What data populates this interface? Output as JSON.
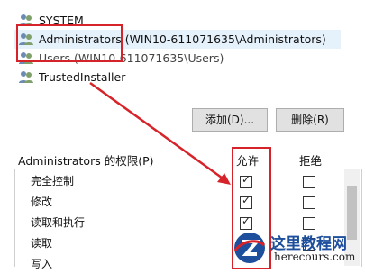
{
  "users": [
    {
      "name": "SYSTEM"
    },
    {
      "name": "Administrators (WIN10-611071635\\Administrators)"
    },
    {
      "name": "Users (WIN10-611071635\\Users)"
    },
    {
      "name": "TrustedInstaller"
    }
  ],
  "buttons": {
    "add": "添加(D)...",
    "remove": "删除(R)"
  },
  "permissions": {
    "title": "Administrators 的权限(P)",
    "allow_header": "允许",
    "deny_header": "拒绝",
    "rows": [
      {
        "label": "完全控制",
        "allow": true,
        "deny": false
      },
      {
        "label": "修改",
        "allow": true,
        "deny": false
      },
      {
        "label": "读取和执行",
        "allow": true,
        "deny": false
      },
      {
        "label": "读取",
        "allow": true,
        "deny": false
      },
      {
        "label": "写入",
        "allow": true,
        "deny": false
      }
    ]
  },
  "watermark": {
    "main": "这里教程网",
    "sub": "herecours.com"
  },
  "colors": {
    "annotation_red": "#d6232a",
    "selection": "#e5f1fb",
    "watermark_blue": "#1d4f9c"
  }
}
